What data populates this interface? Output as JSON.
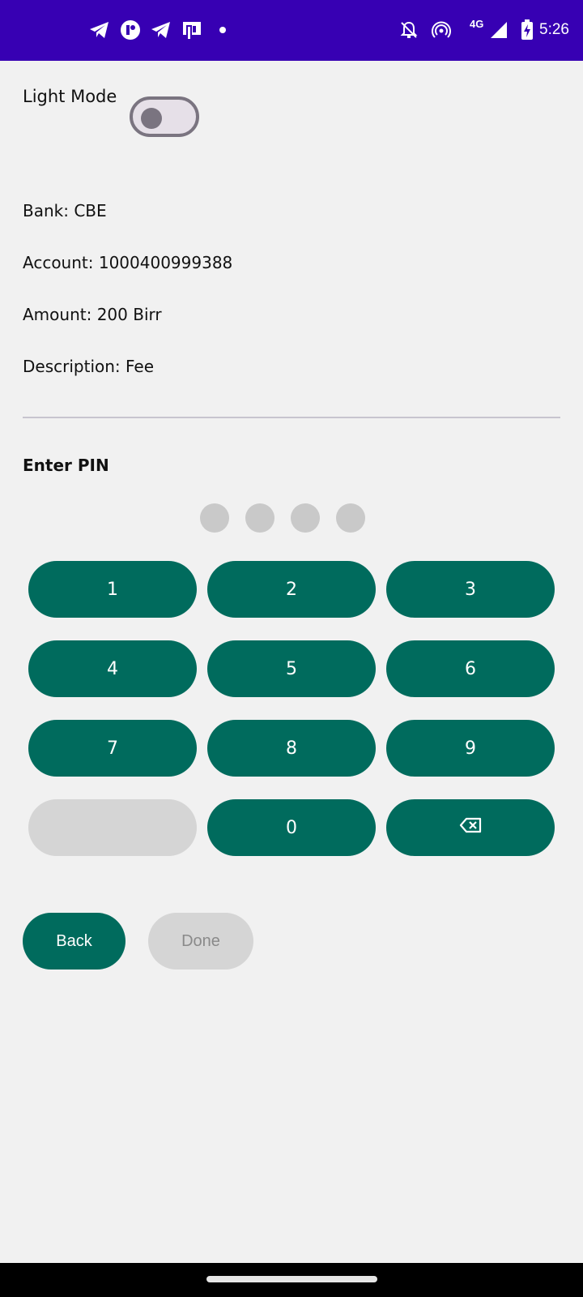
{
  "status_bar": {
    "time": "5:26",
    "network": "4G",
    "left_icons": [
      "telegram-icon",
      "app-notification-icon",
      "telegram-icon",
      "payment-app-icon",
      "dot-icon"
    ],
    "right_icons": [
      "notifications-off-icon",
      "hotspot-icon",
      "signal-icon",
      "battery-charging-icon"
    ],
    "background": "#3700b3"
  },
  "theme": {
    "label": "Light Mode",
    "enabled": false
  },
  "details": {
    "bank": "Bank: CBE",
    "account": "Account: 1000400999388",
    "amount": "Amount: 200 Birr",
    "description": "Description: Fee"
  },
  "pin": {
    "title": "Enter PIN",
    "length": 4,
    "filled": 0
  },
  "keypad": {
    "keys": [
      "1",
      "2",
      "3",
      "4",
      "5",
      "6",
      "7",
      "8",
      "9",
      "",
      "0",
      "backspace-icon"
    ],
    "accent": "#006b5d"
  },
  "actions": {
    "back_label": "Back",
    "done_label": "Done"
  }
}
